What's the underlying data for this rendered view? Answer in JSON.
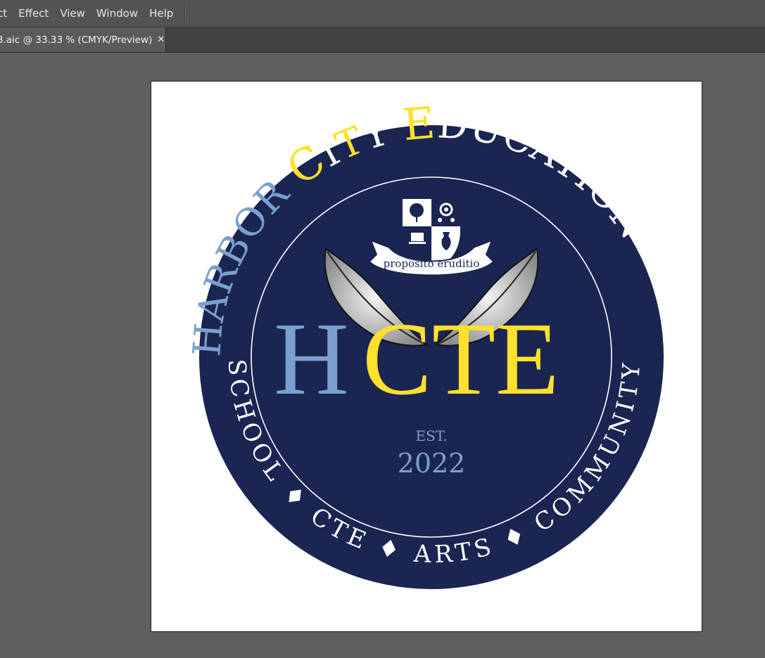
{
  "menubar": {
    "items": [
      "ct",
      "Effect",
      "View",
      "Window",
      "Help"
    ]
  },
  "document_tab": {
    "title": "3.aic @ 33.33 % (CMYK/Preview)",
    "close_glyph": "✕"
  },
  "logo": {
    "top_arc": {
      "part1": "HARBOR ",
      "part2_C": "C",
      "part2_I": "I",
      "part2_T": "T",
      "part2_Y": "Y ",
      "part3_E": "E",
      "part3_rest": "DUCATION"
    },
    "bottom_arc": "SCHOOL ♦ CTE ♦ ARTS ♦ COMMUNITY",
    "monogram_H": "H",
    "monogram_CTE": "CTE",
    "est_label": "EST.",
    "year": "2022",
    "motto": "proposito eruditio",
    "colors": {
      "navy": "#1b2552",
      "light_blue": "#7b9fd1",
      "yellow": "#fde12d",
      "white": "#ffffff"
    },
    "icons": [
      "tree-icon",
      "gear-people-icon",
      "laptop-graduation-icon",
      "vase-icon",
      "laurel-leaf-icon"
    ]
  }
}
